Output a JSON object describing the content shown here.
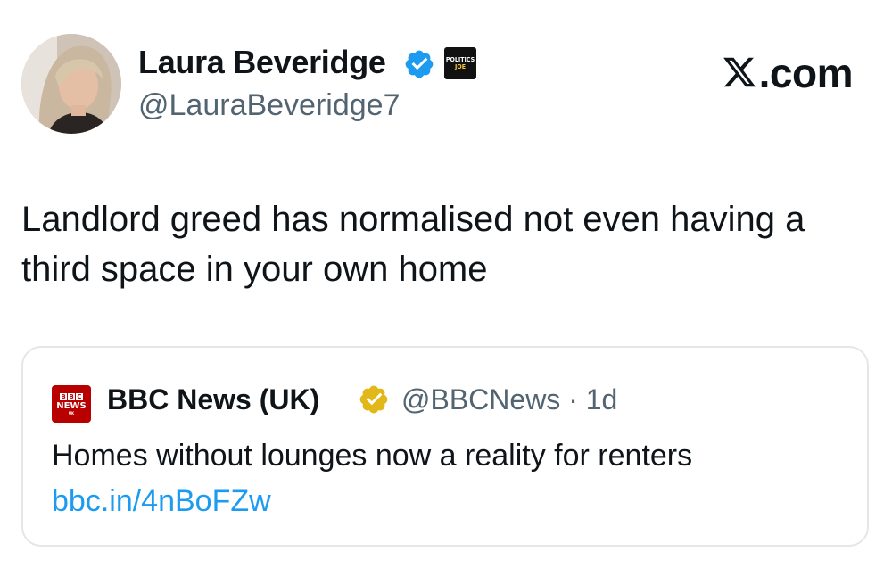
{
  "author": {
    "display_name": "Laura Beveridge",
    "handle": "@LauraBeveridge7",
    "avatar_icon": "profile-photo",
    "verified_icon": "verified-badge-blue",
    "affiliate": {
      "line1": "POLITICS",
      "line2": "JOE"
    }
  },
  "site": {
    "label": ".com",
    "logo_icon": "x-logo"
  },
  "tweet": {
    "text": "Landlord greed has normalised not even having a third space in your own home"
  },
  "quoted_tweet": {
    "logo": {
      "blocks": [
        "B",
        "B",
        "C"
      ],
      "news": "NEWS",
      "region": "UK"
    },
    "display_name": "BBC News (UK)",
    "verified_icon": "verified-badge-gold",
    "handle_time": "@BBCNews · 1d",
    "text": "Homes without lounges now a reality for renters",
    "link": "bbc.in/4nBoFZw"
  },
  "colors": {
    "text_primary": "#0f1419",
    "text_secondary": "#536471",
    "link": "#1d9bf0",
    "verified_blue": "#1d9bf0",
    "verified_gold": "#e2b719",
    "bbc_red": "#b80000",
    "card_border": "#e3e7ea"
  }
}
